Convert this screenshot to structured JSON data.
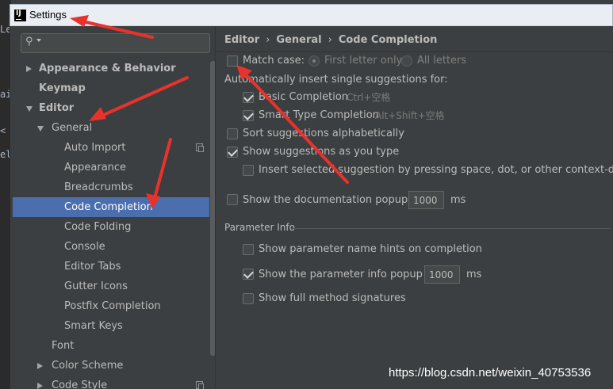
{
  "window": {
    "title": "Settings"
  },
  "behind_editor": {
    "chars": [
      "Le",
      "ai",
      "<",
      "el"
    ]
  },
  "search": {
    "value": "",
    "placeholder": ""
  },
  "tree": [
    {
      "label": "Appearance & Behavior",
      "bold": true,
      "arrow": "right"
    },
    {
      "label": "Keymap",
      "bold": true
    },
    {
      "label": "Editor",
      "bold": true,
      "arrow": "down"
    },
    {
      "label": "General",
      "arrow": "down"
    },
    {
      "label": "Auto Import",
      "icon": "copy-icon"
    },
    {
      "label": "Appearance"
    },
    {
      "label": "Breadcrumbs"
    },
    {
      "label": "Code Completion",
      "selected": true
    },
    {
      "label": "Code Folding"
    },
    {
      "label": "Console"
    },
    {
      "label": "Editor Tabs"
    },
    {
      "label": "Gutter Icons"
    },
    {
      "label": "Postfix Completion"
    },
    {
      "label": "Smart Keys"
    },
    {
      "label": "Font"
    },
    {
      "label": "Color Scheme",
      "arrow": "right"
    },
    {
      "label": "Code Style",
      "arrow": "right",
      "icon": "copy-icon"
    }
  ],
  "breadcrumb": [
    "Editor",
    "General",
    "Code Completion"
  ],
  "options": {
    "match_case": {
      "label": "Match case:",
      "checked": false
    },
    "first_letter_only": {
      "label": "First letter only",
      "selected": true
    },
    "all_letters": {
      "label": "All letters",
      "selected": false
    },
    "auto_insert_heading": "Automatically insert single suggestions for:",
    "basic_completion": {
      "label": "Basic Completion",
      "shortcut": "Ctrl+空格",
      "checked": true
    },
    "smart_type_completion": {
      "label": "Smart Type Completion",
      "shortcut": "Alt+Shift+空格",
      "checked": true
    },
    "sort_alphabetically": {
      "label": "Sort suggestions alphabetically",
      "checked": false
    },
    "show_as_you_type": {
      "label": "Show suggestions as you type",
      "checked": true
    },
    "insert_selected": {
      "label": "Insert selected suggestion by pressing space, dot, or other context-depende",
      "checked": false
    },
    "doc_popup": {
      "label": "Show the documentation popup in",
      "value": "1000",
      "unit": "ms",
      "checked": false
    }
  },
  "parameter_info": {
    "title": "Parameter Info",
    "name_hints": {
      "label": "Show parameter name hints on completion",
      "checked": false
    },
    "info_popup": {
      "label": "Show the parameter info popup in",
      "value": "1000",
      "unit": "ms",
      "checked": true
    },
    "full_signatures": {
      "label": "Show full method signatures",
      "checked": false
    }
  },
  "watermark": "https://blog.csdn.net/weixin_40753536",
  "colors": {
    "selection": "#4b6eaf",
    "panel": "#3c3f41",
    "text": "#bbbbbb",
    "annotation": "#e8322b"
  }
}
